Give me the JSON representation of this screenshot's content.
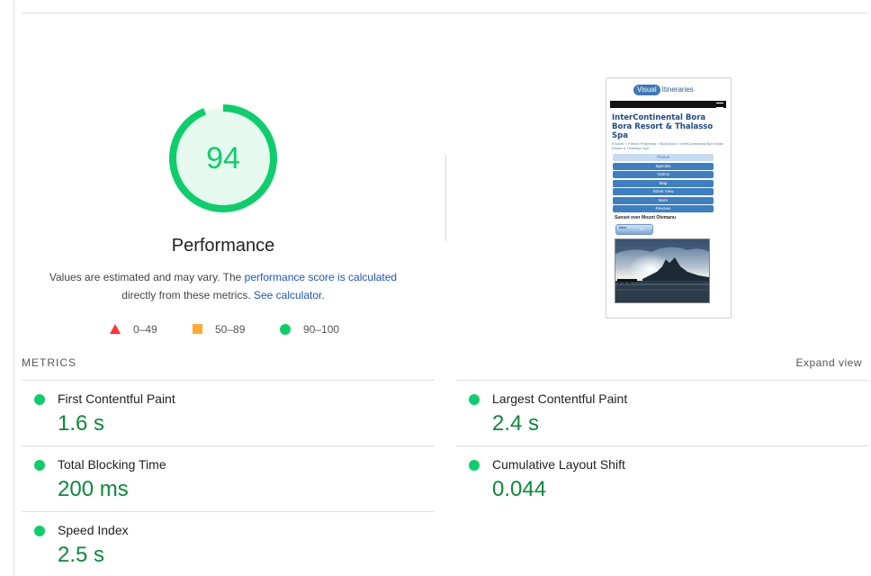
{
  "score": {
    "value": "94",
    "numeric": 94,
    "title": "Performance",
    "color": "#0cce6b"
  },
  "description": {
    "text1": "Values are estimated and may vary. The ",
    "link1": "performance score is calculated",
    "text2": " directly from these metrics. ",
    "link2": "See calculator",
    "text3": "."
  },
  "legend": [
    {
      "icon": "triangle-red-icon",
      "range": "0–49",
      "color": "#ff3333"
    },
    {
      "icon": "square-orange-icon",
      "range": "50–89",
      "color": "#ffaa33"
    },
    {
      "icon": "circle-green-icon",
      "range": "90–100",
      "color": "#0cce6b"
    }
  ],
  "screenshot": {
    "logo_pill": "Visual",
    "logo_text": "Itineraries",
    "title": "InterContinental Bora Bora Resort & Thalasso Spa",
    "breadcrumb": "Explore > French Polynesia > Bora Bora > InterContinental Bora Bora Resort & Thalasso Spa",
    "buttons": [
      "Photos",
      "Specials",
      "Videos",
      "Map",
      "Street View",
      "More",
      "Reviews"
    ],
    "caption": "Sunset over Mount Otemanu",
    "next_label": "Next",
    "next_arrow": "»»"
  },
  "metrics": {
    "header": "METRICS",
    "expand_label": "Expand view",
    "items": [
      {
        "name": "First Contentful Paint",
        "value": "1.6 s"
      },
      {
        "name": "Largest Contentful Paint",
        "value": "2.4 s"
      },
      {
        "name": "Total Blocking Time",
        "value": "200 ms"
      },
      {
        "name": "Cumulative Layout Shift",
        "value": "0.044"
      },
      {
        "name": "Speed Index",
        "value": "2.5 s"
      }
    ]
  }
}
